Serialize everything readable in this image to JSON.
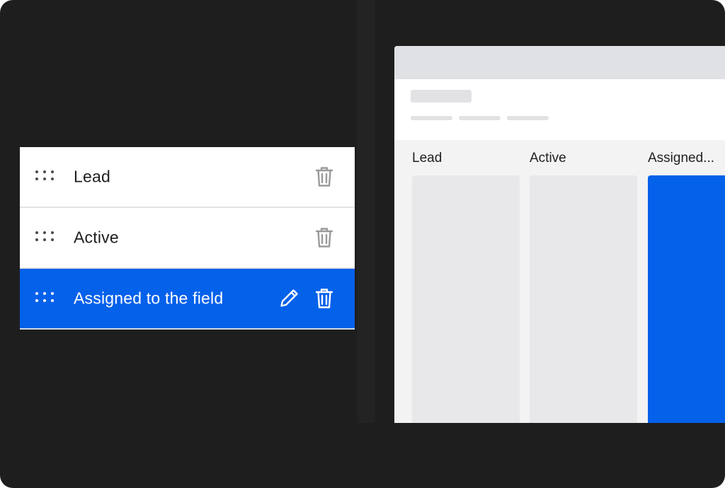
{
  "status_list": {
    "items": [
      {
        "label": "Lead",
        "selected": false
      },
      {
        "label": "Active",
        "selected": false
      },
      {
        "label": "Assigned to the field",
        "selected": true
      }
    ],
    "icons": {
      "drag": "drag-handle-icon",
      "delete": "trash-icon",
      "edit": "pencil-icon"
    }
  },
  "preview": {
    "columns": [
      {
        "title": "Lead"
      },
      {
        "title": "Active"
      },
      {
        "title": "Assigned..."
      }
    ]
  },
  "colors": {
    "background": "#1e1e1e",
    "accent": "#0461ea",
    "row_bg": "#ffffff",
    "placeholder": "#e8e8ea"
  }
}
